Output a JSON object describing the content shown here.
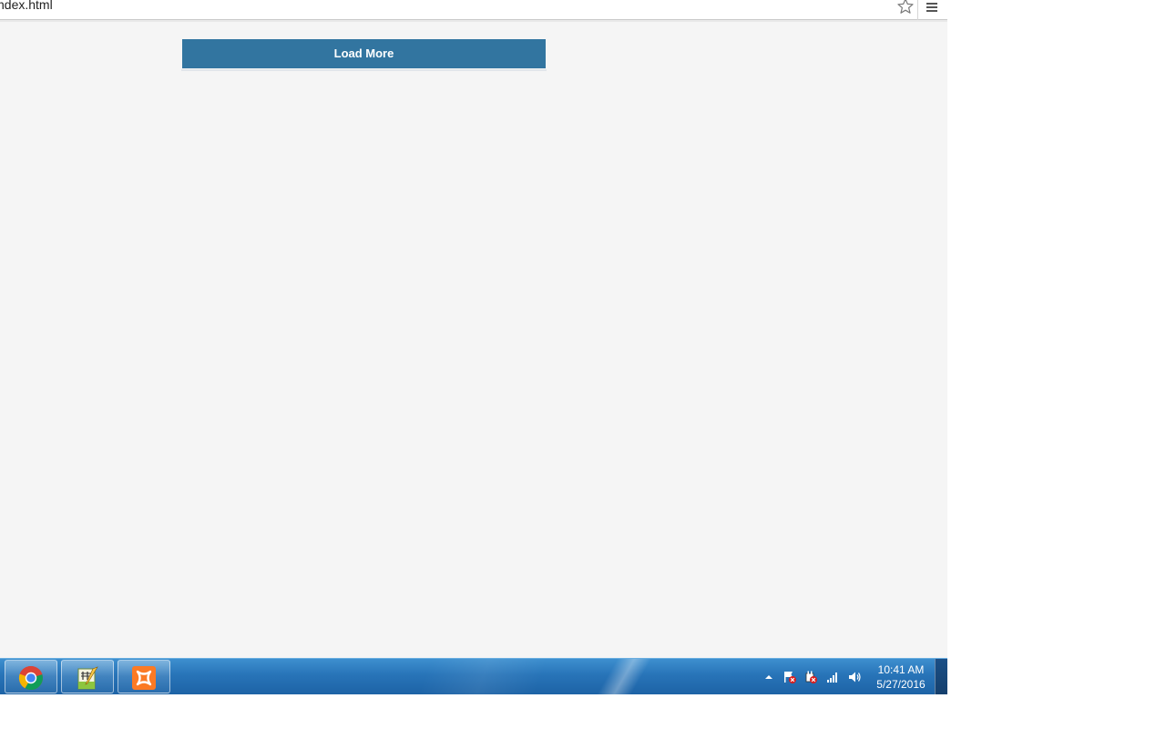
{
  "browser": {
    "url": "ndex.html",
    "bookmark_icon": "star-outline-icon",
    "menu_icon": "hamburger-menu-icon"
  },
  "page": {
    "load_more_label": "Load More",
    "button_color": "#3275a0",
    "background_color": "#f5f5f5"
  },
  "taskbar": {
    "pinned": [
      {
        "name": "chrome",
        "icon": "chrome-icon"
      },
      {
        "name": "notepad-plus",
        "icon": "notepad-edit-icon"
      },
      {
        "name": "xampp",
        "icon": "xampp-icon"
      }
    ],
    "tray_icons": [
      "show-hidden-icons-arrow",
      "action-center-flag-icon",
      "power-plug-icon",
      "network-signal-icon",
      "volume-icon"
    ],
    "clock": {
      "time": "10:41 AM",
      "date": "5/27/2016"
    }
  }
}
